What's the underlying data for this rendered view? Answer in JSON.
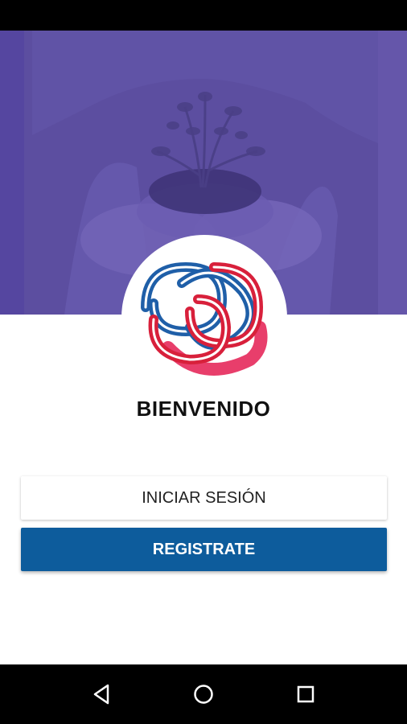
{
  "welcome": {
    "title": "BIENVENIDO"
  },
  "buttons": {
    "login_label": "INICIAR SESIÓN",
    "register_label": "REGISTRATE"
  },
  "hero": {
    "image": "hands-holding-plant"
  },
  "logo": {
    "image": "interlaced-knot-logo"
  },
  "navigation": {
    "back": "back-triangle-icon",
    "home": "home-circle-icon",
    "recents": "recents-square-icon"
  },
  "colors": {
    "hero_overlay": "#5c4ea0",
    "primary": "#0d5c9c",
    "logo_blue": "#1f5fa8",
    "logo_red": "#d8203b",
    "logo_pink": "#e83e6b"
  }
}
